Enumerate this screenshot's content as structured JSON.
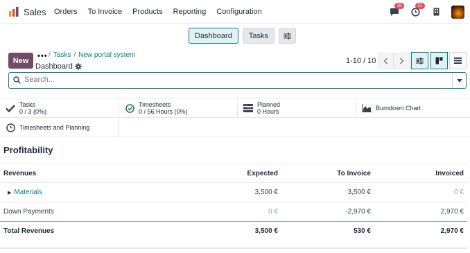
{
  "navbar": {
    "app_name": "Sales",
    "menu": [
      "Orders",
      "To Invoice",
      "Products",
      "Reporting",
      "Configuration"
    ],
    "messages_count": "18",
    "activities_count": "31"
  },
  "view_switch": {
    "dashboard": "Dashboard",
    "tasks": "Tasks"
  },
  "control": {
    "new_label": "New",
    "crumb_1": "Tasks",
    "crumb_2": "New portal system",
    "title": "Dashboard",
    "pager": "1-10 / 10"
  },
  "search": {
    "placeholder": "Search..."
  },
  "stats": [
    {
      "label": "Tasks",
      "value": "0 / 3 (0%)"
    },
    {
      "label": "Timesheets",
      "value": "0 / 56 Hours (0%)"
    },
    {
      "label": "Planned",
      "value": "0 Hours"
    },
    {
      "label": "Burndown Chart",
      "value": ""
    },
    {
      "label": "Timesheets and Planning",
      "value": ""
    }
  ],
  "profitability": {
    "title": "Profitability",
    "headers": [
      "Revenues",
      "Expected",
      "To Invoice",
      "Invoiced"
    ],
    "rows": [
      {
        "label": "Materials",
        "expected": "3,500 €",
        "to_invoice": "3,500 €",
        "invoiced": "0 €"
      },
      {
        "label": "Down Payments",
        "expected": "0 €",
        "to_invoice": "-2,970 €",
        "invoiced": "2,970 €"
      }
    ],
    "total": {
      "label": "Total Revenues",
      "expected": "3,500 €",
      "to_invoice": "530 €",
      "invoiced": "2,970 €"
    }
  },
  "colors": {
    "brand": "#714b67",
    "accent": "#017e84",
    "badge": "#e4485b"
  }
}
